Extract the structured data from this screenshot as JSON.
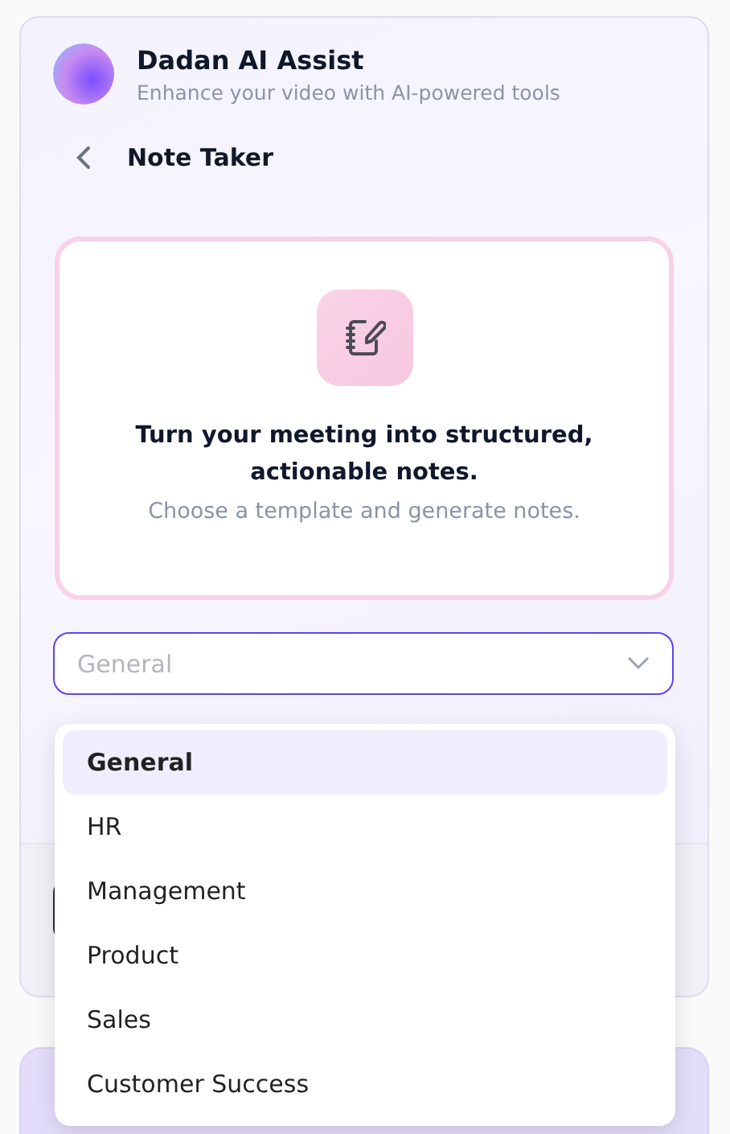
{
  "app": {
    "title": "Dadan AI Assist",
    "subtitle": "Enhance your video with AI-powered tools"
  },
  "page": {
    "title": "Note Taker"
  },
  "intro": {
    "heading": "Turn your meeting into structured, actionable notes.",
    "text": "Choose a template and generate notes."
  },
  "template_select": {
    "placeholder": "General",
    "expanded": true
  },
  "options": [
    {
      "label": "General",
      "selected": true
    },
    {
      "label": "HR",
      "selected": false
    },
    {
      "label": "Management",
      "selected": false
    },
    {
      "label": "Product",
      "selected": false
    },
    {
      "label": "Sales",
      "selected": false
    },
    {
      "label": "Customer Success",
      "selected": false
    }
  ]
}
